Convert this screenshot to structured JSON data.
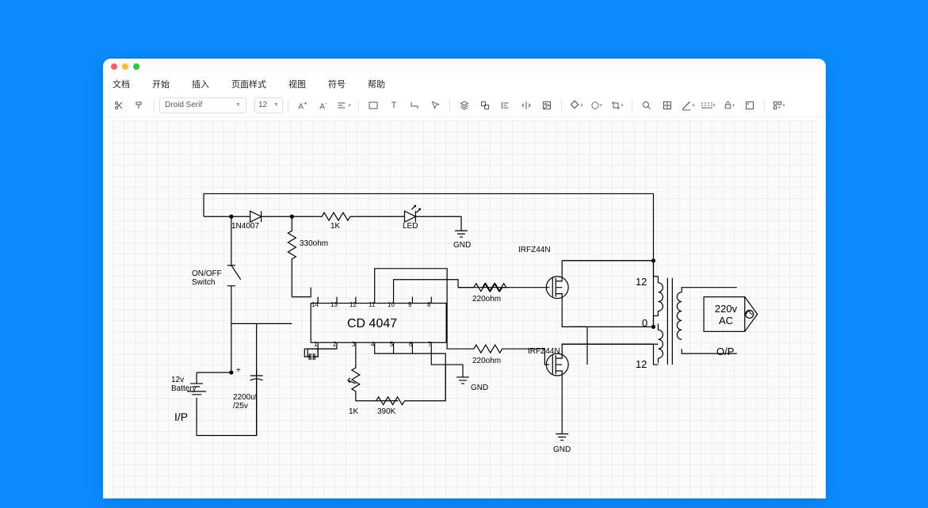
{
  "menu": [
    "文档",
    "开始",
    "插入",
    "页面样式",
    "视图",
    "符号",
    "帮助"
  ],
  "font": "Droid Serif",
  "fontsize": "12",
  "circuit": {
    "diode": "1N4007",
    "r1k_top": "1K",
    "led": "LED",
    "gnd_top": "GND",
    "r330": "330ohm",
    "switch": "ON/OFF\nSwitch",
    "irfz44n": "IRFZ44N",
    "chip": "CD 4047",
    "pins_top": [
      "14",
      "13",
      "12",
      "11",
      "10",
      "9",
      "8"
    ],
    "pins_bot": [
      "1",
      "2",
      "3",
      "4",
      "5",
      "6",
      "7"
    ],
    "r220_1": "220ohm",
    "r220_2": "220ohm",
    "battery": "12v\nBattery",
    "ip": "I/P",
    "cap": "2200uf\n/25v",
    "r1k_bot": "1K",
    "r390k": "390K",
    "gnd_mid": "GND",
    "gnd_bot": "GND",
    "t12a": "12",
    "t0": "0",
    "t12b": "12",
    "out": "220v\nAC",
    "op": "O/P",
    "plus": "+"
  }
}
